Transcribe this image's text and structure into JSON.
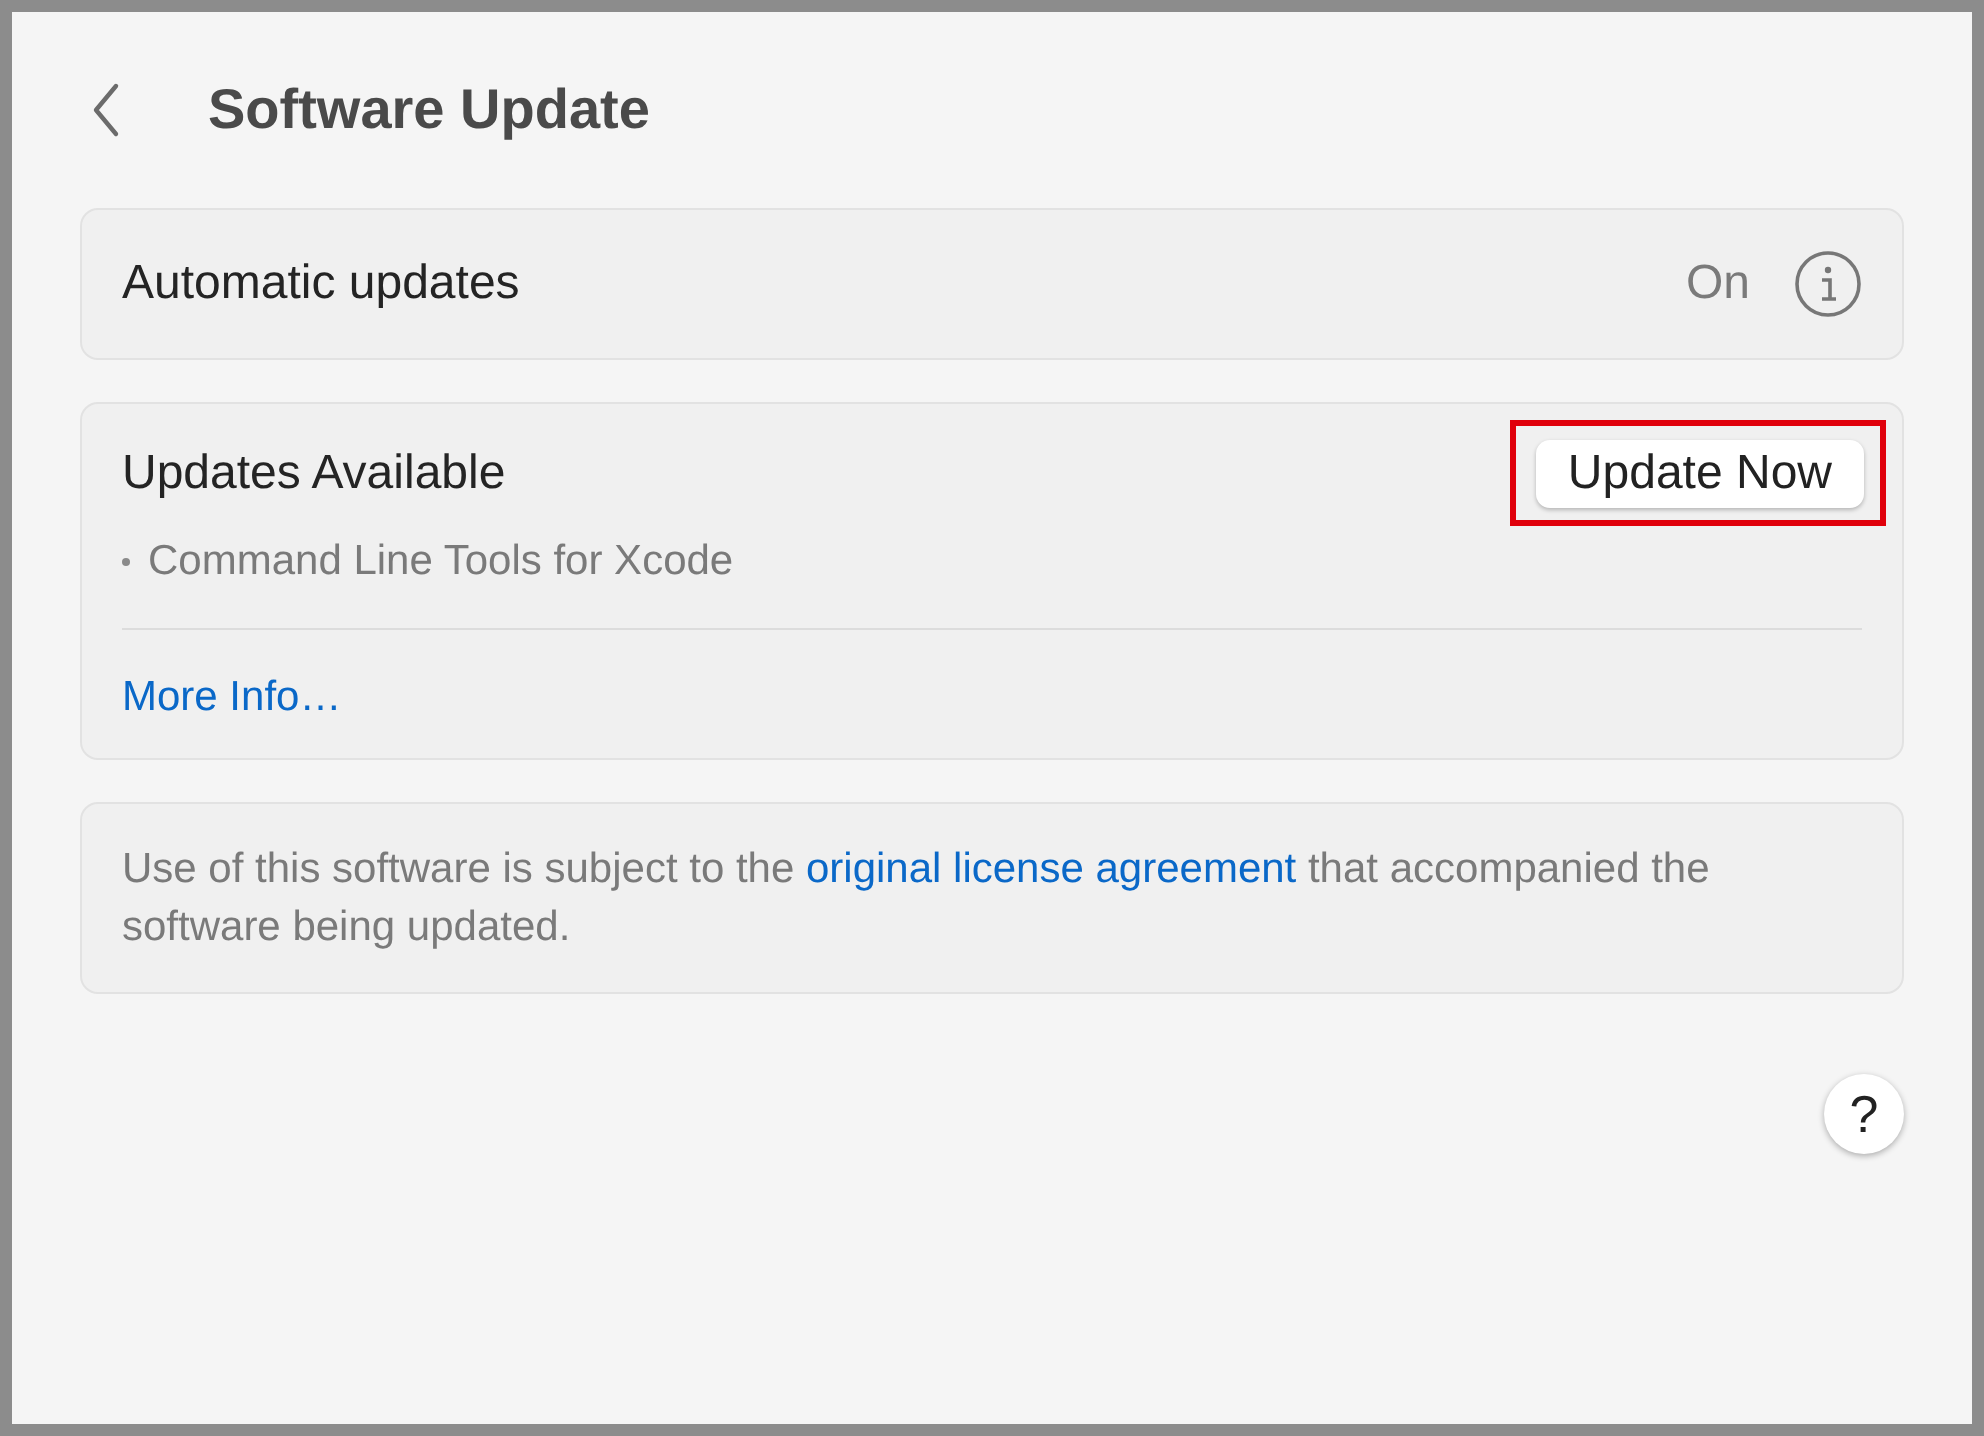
{
  "header": {
    "title": "Software Update"
  },
  "automatic_updates": {
    "label": "Automatic updates",
    "value": "On"
  },
  "updates": {
    "title": "Updates Available",
    "button": {
      "label": "Update Now",
      "highlighted": true
    },
    "items": [
      "Command Line Tools for Xcode"
    ],
    "link": "More Info…"
  },
  "license": {
    "before": "Use of this software is subject to the ",
    "link": "original license agreement",
    "after": " that accompanied the software being updated."
  },
  "help_button": "?"
}
